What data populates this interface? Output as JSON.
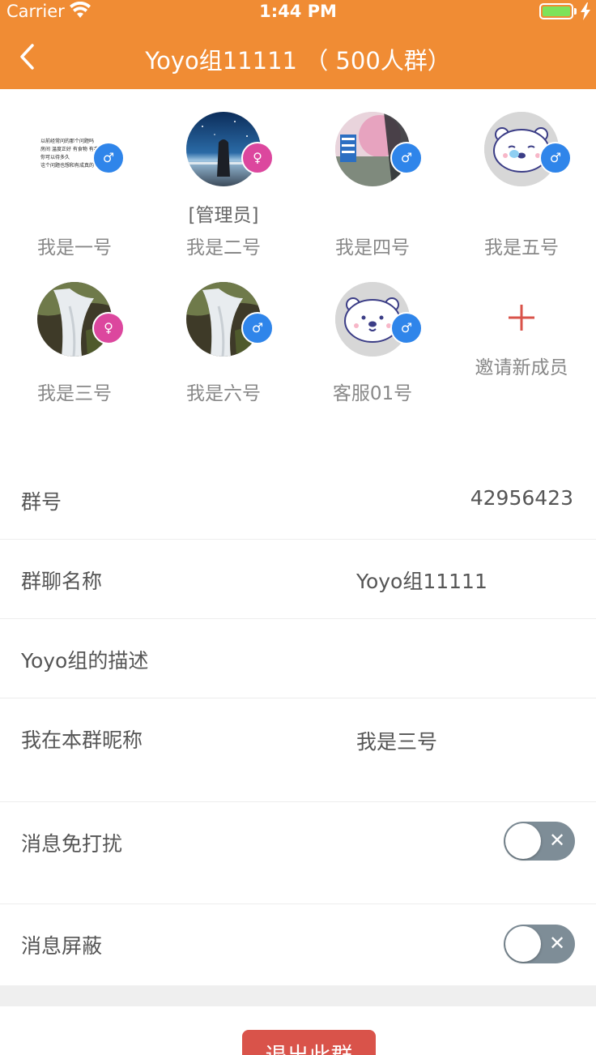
{
  "status_bar": {
    "carrier": "Carrier",
    "time": "1:44 PM"
  },
  "nav": {
    "title": "Yoyo组11111 （ 500人群）"
  },
  "members": [
    {
      "name": "我是一号",
      "role": "",
      "gender": "male",
      "gender_symbol": "♂",
      "avatar": "text-screenshot"
    },
    {
      "name": "我是二号",
      "role": "[管理员]",
      "gender": "female",
      "gender_symbol": "♀",
      "avatar": "night-sky"
    },
    {
      "name": "我是四号",
      "role": "",
      "gender": "male",
      "gender_symbol": "♂",
      "avatar": "street-photo"
    },
    {
      "name": "我是五号",
      "role": "",
      "gender": "male",
      "gender_symbol": "♂",
      "avatar": "polar-bear"
    },
    {
      "name": "我是三号",
      "role": "",
      "gender": "female",
      "gender_symbol": "♀",
      "avatar": "waterfall"
    },
    {
      "name": "我是六号",
      "role": "",
      "gender": "male",
      "gender_symbol": "♂",
      "avatar": "waterfall"
    },
    {
      "name": "客服01号",
      "role": "",
      "gender": "male",
      "gender_symbol": "♂",
      "avatar": "polar-bear"
    }
  ],
  "invite": {
    "label": "邀请新成员",
    "icon": "plus-icon"
  },
  "avatar_text_lines": [
    "以前经常问的那个问题吗",
    "房间 温度正好 有食物 有手机 有",
    "你可以待多久",
    "这个问题也想和有成真的一"
  ],
  "settings": {
    "group_id": {
      "label": "群号",
      "value": "42956423"
    },
    "group_name": {
      "label": "群聊名称",
      "value": "Yoyo组11111"
    },
    "description": {
      "label": "Yoyo组的描述"
    },
    "nickname": {
      "label": "我在本群昵称",
      "value": "我是三号"
    },
    "mute": {
      "label": "消息免打扰",
      "on": false
    },
    "block": {
      "label": "消息屏蔽",
      "on": false
    }
  },
  "exit_button": {
    "label": "退出此群"
  },
  "colors": {
    "accent": "#f08c34",
    "male": "#2f85ea",
    "female": "#dc479e",
    "danger": "#d9534a",
    "toggle_off": "#7e8d97"
  }
}
